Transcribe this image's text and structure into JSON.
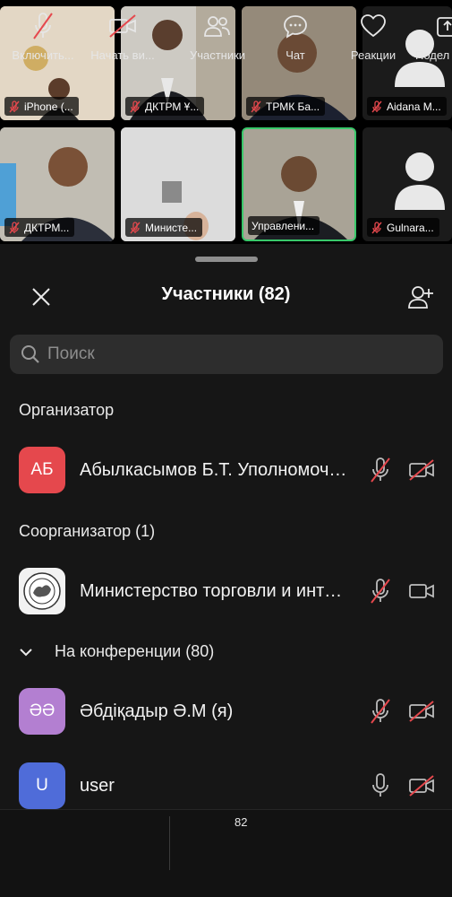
{
  "video_tiles": [
    {
      "caption": "iPhone (...",
      "muted": true
    },
    {
      "caption": "ДКТРМ Ұ...",
      "muted": true
    },
    {
      "caption": "ТРМК Ба...",
      "muted": true
    },
    {
      "caption": "Aidana M...",
      "muted": true
    },
    {
      "caption": "ДКТРМ...",
      "muted": true
    },
    {
      "caption": "Министе...",
      "muted": true
    },
    {
      "caption": "Управлени...",
      "muted": false
    },
    {
      "caption": "Gulnara...",
      "muted": true
    }
  ],
  "panel": {
    "title": "Участники (82)",
    "search_placeholder": "Поиск"
  },
  "sections": {
    "host": "Организатор",
    "cohost": "Соорганизатор (1)",
    "in_meeting": "На конференции (80)"
  },
  "participants": [
    {
      "initials": "АБ",
      "name": "Абылкасымов Б.Т. Уполномоченный",
      "avatar_color": "#e5484d",
      "mic_muted": true,
      "cam_off": true
    },
    {
      "initials": "",
      "name": "Министерство торговли и интеграции",
      "avatar_color": "#f2f2f2",
      "mic_muted": true,
      "cam_off": false
    },
    {
      "initials": "ӘӘ",
      "name": "Әбдіқадыр Ә.М (я)",
      "avatar_color": "#b37fd1",
      "mic_muted": true,
      "cam_off": true
    },
    {
      "initials": "U",
      "name": "user",
      "avatar_color": "#4f6cd9",
      "mic_muted": false,
      "cam_off": true
    }
  ],
  "toolbar": {
    "unmute": "Включить...",
    "start_video": "Начать ви...",
    "participants": "Участники",
    "participants_count": "82",
    "chat": "Чат",
    "reactions": "Реакции",
    "share": "Подел"
  },
  "colors": {
    "muted_red": "#e5484d",
    "active_speaker": "#39c86a",
    "panel_bg": "#161616"
  }
}
